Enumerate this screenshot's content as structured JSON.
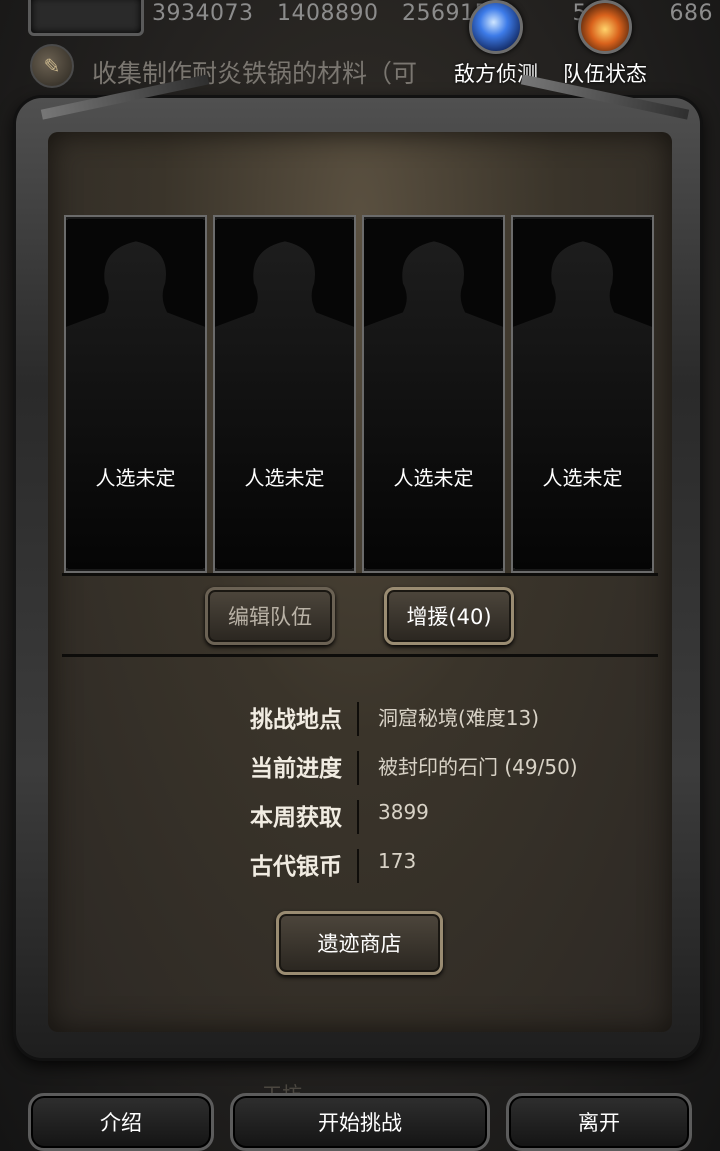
{
  "hud": {
    "stats": [
      "3934073",
      "1408890",
      "256915",
      "504",
      "686"
    ],
    "quest_text": "收集制作耐炎铁锅的材料（",
    "quest_text_tail": "可",
    "enemy_scout_label": "敌方侦测",
    "team_status_label": "队伍状态"
  },
  "slots": [
    {
      "label": "人选未定"
    },
    {
      "label": "人选未定"
    },
    {
      "label": "人选未定"
    },
    {
      "label": "人选未定"
    }
  ],
  "actions": {
    "edit_team": "编辑队伍",
    "reinforce": "增援(40)"
  },
  "info": {
    "location_key": "挑战地点",
    "location_val": "洞窟秘境(难度13)",
    "progress_key": "当前进度",
    "progress_val": "被封印的石门 (49/50)",
    "weekly_key": "本周获取",
    "weekly_val": "3899",
    "coin_key": "古代银币",
    "coin_val": "173"
  },
  "shop_button": "遗迹商店",
  "bottom": {
    "intro": "介绍",
    "start": "开始挑战",
    "leave": "离开"
  },
  "ghost_text": "工坊",
  "colors": {
    "panel_bg": "#3a342a",
    "text_white": "#ffffff",
    "accent_button_border": "#9a8c72"
  }
}
